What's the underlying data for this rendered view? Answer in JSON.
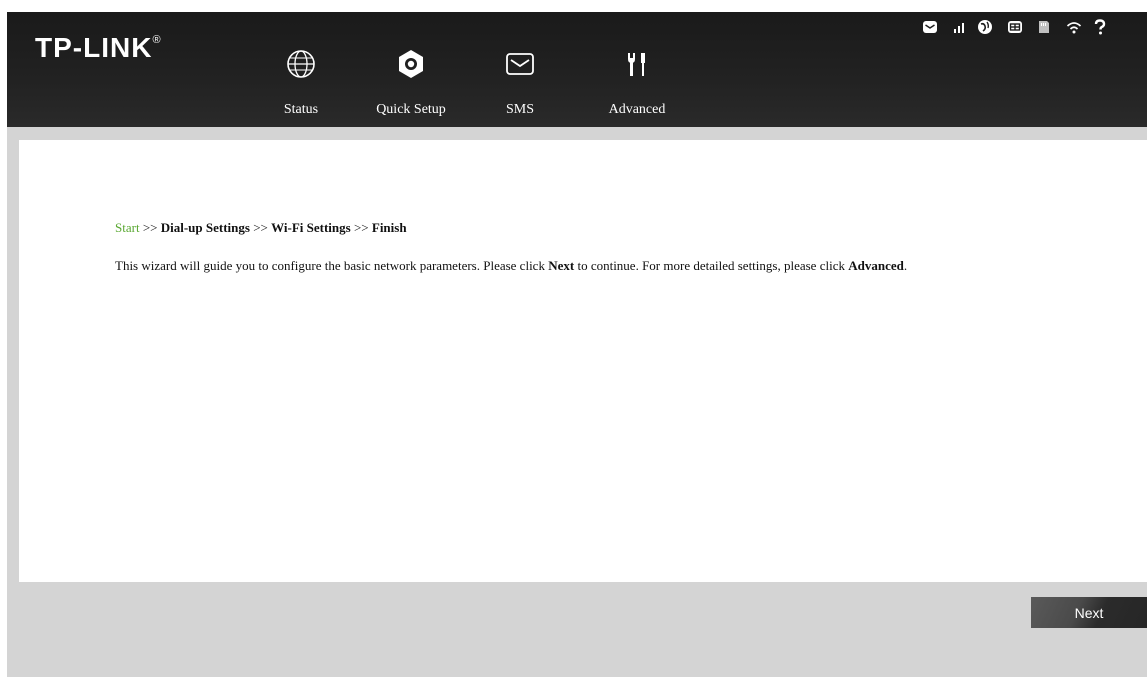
{
  "brand": {
    "logo_text": "TP-LINK",
    "trademark": "®"
  },
  "nav": {
    "items": [
      {
        "label": "Status",
        "icon": "globe-icon"
      },
      {
        "label": "Quick Setup",
        "icon": "gear-icon"
      },
      {
        "label": "SMS",
        "icon": "envelope-icon"
      },
      {
        "label": "Advanced",
        "icon": "tools-icon"
      }
    ]
  },
  "status_bar": {
    "icons": [
      "message-icon",
      "signal-strength-icon",
      "internet-globe-icon",
      "network-type-icon",
      "sim-card-icon",
      "wifi-icon",
      "help-icon"
    ]
  },
  "breadcrumb": {
    "start": "Start",
    "sep1": ">>",
    "step2": "Dial-up Settings",
    "sep2": ">>",
    "step3": "Wi-Fi Settings",
    "sep3": ">>",
    "step4": "Finish"
  },
  "description": {
    "part1": "This wizard will guide you to configure the basic network parameters. Please click ",
    "next_word": "Next",
    "part2": " to continue. For more detailed settings, please click ",
    "advanced_word": "Advanced",
    "part3": "."
  },
  "buttons": {
    "next_label": "Next"
  },
  "colors": {
    "accent_green": "#5aa832",
    "header_bg": "#1f1f1f",
    "page_bg": "#d4d4d4"
  }
}
